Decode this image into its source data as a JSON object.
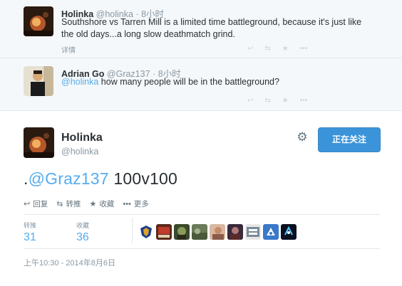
{
  "context_tweets": [
    {
      "name": "Holinka",
      "handle": "@holinka",
      "sep": "·",
      "time": "8小时",
      "text_line1": "Southshore vs Tarren Mill is a limited time battleground, because it's just like",
      "text_line2": "the old days...a long slow deathmatch grind.",
      "detail": "详情"
    },
    {
      "name": "Adrian Go",
      "handle": "@Graz137",
      "sep": "·",
      "time": "8小时",
      "mention": "@holinka",
      "text": " how many people will be in the battleground?"
    }
  ],
  "main_tweet": {
    "name": "Holinka",
    "handle": "@holinka",
    "follow_label": "正在关注",
    "text_prefix": ".",
    "text_mention": "@Graz137",
    "text_rest": " 100v100",
    "actions": {
      "reply": "回复",
      "retweet": "转推",
      "favorite": "收藏",
      "more": "更多"
    },
    "stats": {
      "retweets_label": "转推",
      "retweets_value": "31",
      "favorites_label": "收藏",
      "favorites_value": "36"
    },
    "timestamp": "上午10:30 - 2014年8月6日"
  },
  "icons": {
    "gear": "gear-icon",
    "reply": "reply-icon",
    "retweet": "retweet-icon",
    "favorite": "star-icon",
    "more": "more-dots-icon"
  },
  "colors": {
    "accent": "#55acee",
    "follow_button": "#3b94d9",
    "muted": "#8899a6"
  }
}
